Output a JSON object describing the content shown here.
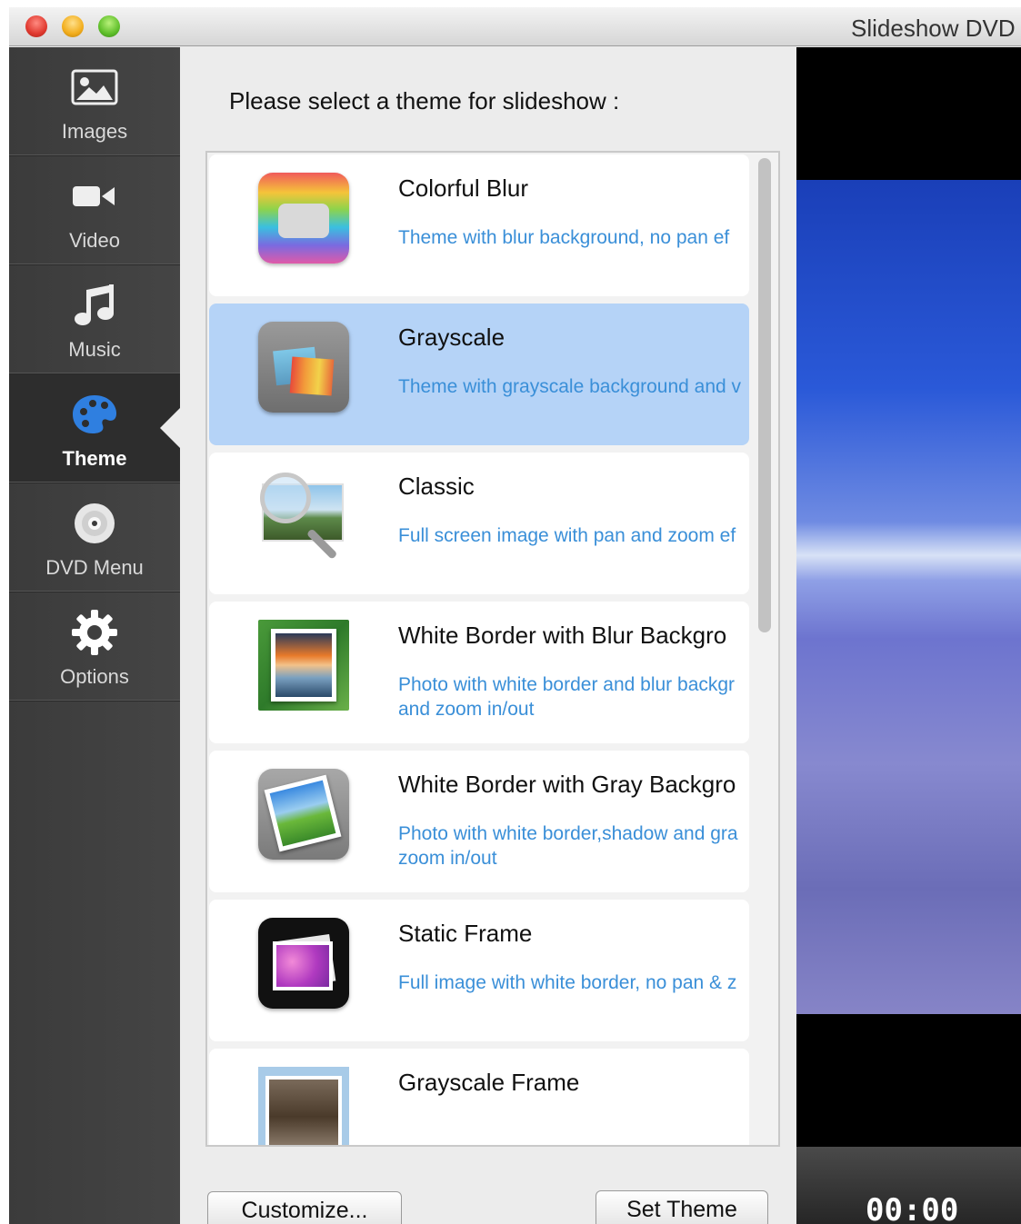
{
  "app": {
    "title": "Slideshow DVD"
  },
  "sidebar": {
    "items": [
      {
        "label": "Images",
        "icon": "image-icon",
        "active": false
      },
      {
        "label": "Video",
        "icon": "video-camera-icon",
        "active": false
      },
      {
        "label": "Music",
        "icon": "music-note-icon",
        "active": false
      },
      {
        "label": "Theme",
        "icon": "palette-icon",
        "active": true
      },
      {
        "label": "DVD Menu",
        "icon": "disc-icon",
        "active": false
      },
      {
        "label": "Options",
        "icon": "gear-icon",
        "active": false
      }
    ]
  },
  "main": {
    "prompt": "Please select a theme for slideshow :",
    "themes": [
      {
        "name": "Colorful Blur",
        "description": "Theme with blur background, no pan ef",
        "selected": false
      },
      {
        "name": "Grayscale",
        "description": "Theme with grayscale background and v",
        "selected": true
      },
      {
        "name": "Classic",
        "description": "Full screen image with pan and zoom ef",
        "selected": false
      },
      {
        "name": "White Border with Blur Backgro",
        "description": "Photo with white border and blur backgr and zoom in/out",
        "selected": false
      },
      {
        "name": "White Border with Gray Backgro",
        "description": "Photo with white border,shadow and gra zoom in/out",
        "selected": false
      },
      {
        "name": "Static Frame",
        "description": "Full image with white border, no pan & z",
        "selected": false
      },
      {
        "name": "Grayscale Frame",
        "description": "",
        "selected": false
      }
    ],
    "buttons": {
      "customize": "Customize...",
      "set_theme": "Set Theme"
    }
  },
  "preview": {
    "timecode": "00:00"
  },
  "colors": {
    "selection": "#b5d3f7",
    "description_text": "#3a8fd8",
    "sidebar_bg": "#3b3b3b"
  }
}
